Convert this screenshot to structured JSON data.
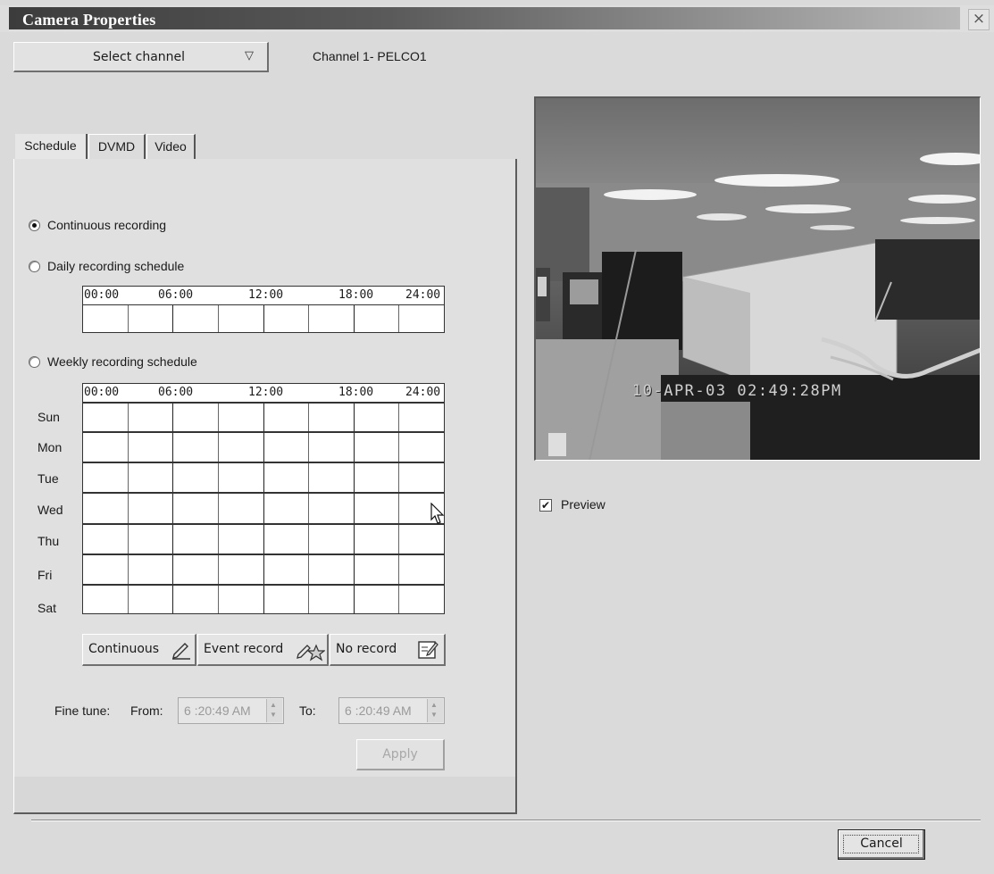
{
  "window": {
    "title": "Camera Properties",
    "close_glyph": "×"
  },
  "channel": {
    "select_label": "Select channel",
    "select_arrow": "▽",
    "current": "Channel 1- PELCO1"
  },
  "tabs": [
    {
      "label": "Schedule",
      "active": true
    },
    {
      "label": "DVMD",
      "active": false
    },
    {
      "label": "Video",
      "active": false
    }
  ],
  "schedule": {
    "options": [
      {
        "label": "Continuous recording",
        "selected": true
      },
      {
        "label": "Daily recording schedule",
        "selected": false
      },
      {
        "label": "Weekly recording schedule",
        "selected": false
      }
    ],
    "time_ticks": [
      "00:00",
      "06:00",
      "12:00",
      "18:00",
      "24:00"
    ],
    "days": [
      "Sun",
      "Mon",
      "Tue",
      "Wed",
      "Thu",
      "Fri",
      "Sat"
    ],
    "mode_buttons": [
      {
        "label": "Continuous",
        "icon": "pencil-icon"
      },
      {
        "label": "Event record",
        "icon": "pencil-star-icon"
      },
      {
        "label": "No record",
        "icon": "note-icon"
      }
    ],
    "fine_tune": {
      "label": "Fine tune:",
      "from_label": "From:",
      "from_value": "6 :20:49 AM",
      "to_label": "To:",
      "to_value": "6 :20:49 AM"
    },
    "apply_label": "Apply"
  },
  "preview": {
    "overlay_text": "10-APR-03 02:49:28PM",
    "checkbox_label": "Preview",
    "checked": true
  },
  "footer": {
    "cancel_label": "Cancel"
  }
}
